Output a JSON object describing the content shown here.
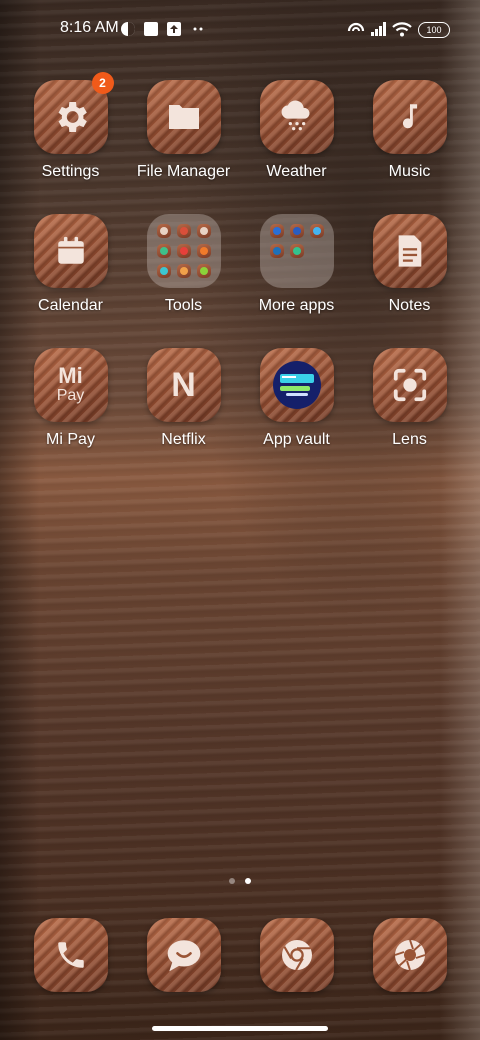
{
  "status": {
    "time": "8:16 AM",
    "battery": "100",
    "icons": [
      "vpn-icon",
      "screenshot-icon",
      "upload-icon",
      "more-dots-icon",
      "hotspot-icon",
      "signal-icon",
      "wifi-icon"
    ]
  },
  "apps": [
    {
      "label": "Settings",
      "icon": "gear-icon",
      "badge": "2"
    },
    {
      "label": "File Manager",
      "icon": "folder-icon"
    },
    {
      "label": "Weather",
      "icon": "weather-icon"
    },
    {
      "label": "Music",
      "icon": "music-note-icon"
    },
    {
      "label": "Calendar",
      "icon": "calendar-icon"
    },
    {
      "label": "Tools",
      "icon": "folder-tools"
    },
    {
      "label": "More apps",
      "icon": "folder-more-apps"
    },
    {
      "label": "Notes",
      "icon": "notes-icon"
    },
    {
      "label": "Mi Pay",
      "icon": "mi-pay-icon",
      "glyph_top": "Mi",
      "glyph_bottom": "Pay"
    },
    {
      "label": "Netflix",
      "icon": "netflix-icon",
      "glyph": "N"
    },
    {
      "label": "App vault",
      "icon": "app-vault-icon"
    },
    {
      "label": "Lens",
      "icon": "lens-icon"
    }
  ],
  "dock": [
    {
      "icon": "phone-icon"
    },
    {
      "icon": "messages-icon"
    },
    {
      "icon": "chrome-icon"
    },
    {
      "icon": "camera-icon"
    }
  ],
  "colors": {
    "badge": "#f05a1a",
    "tile": "#9a5536"
  }
}
